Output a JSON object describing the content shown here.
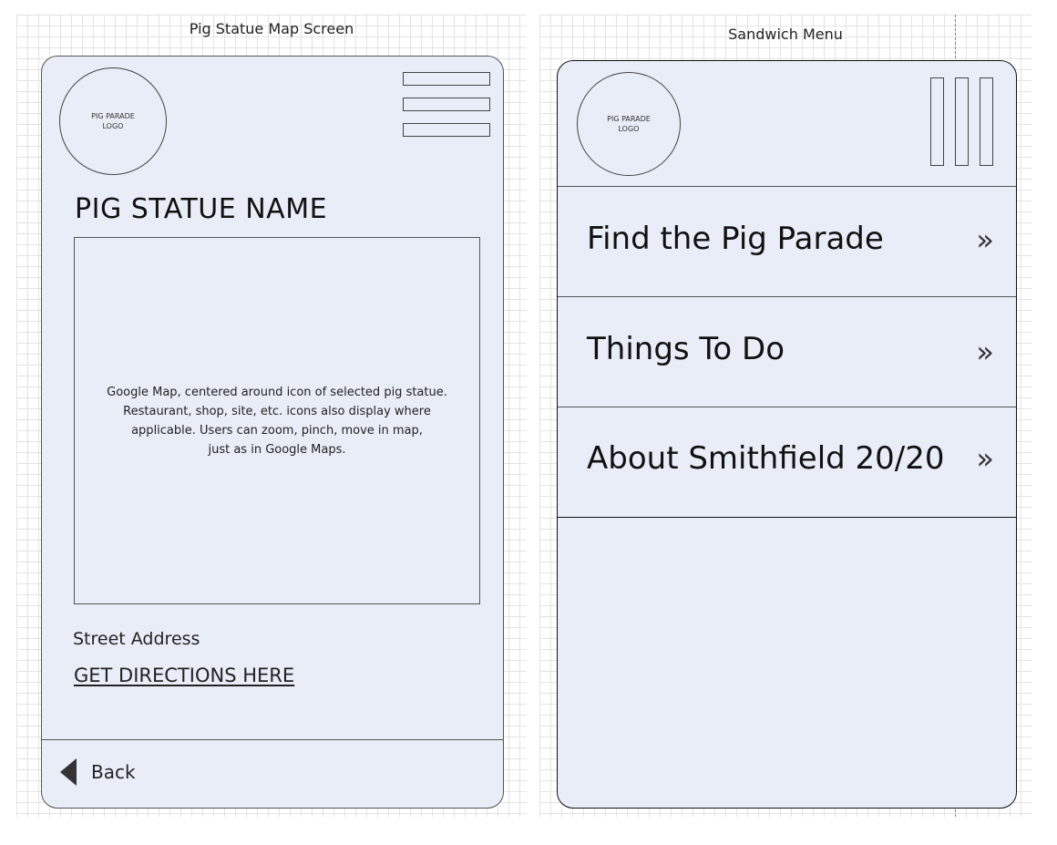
{
  "left_screen": {
    "caption": "Pig Statue Map Screen",
    "logo_text": "PIG PARADE\nLOGO",
    "statue_title": "PIG STATUE NAME",
    "map_description": "Google Map, centered around icon of selected pig statue.\nRestaurant, shop, site, etc. icons also display where\napplicable. Users can zoom, pinch, move in map,\njust as in Google Maps.",
    "street_address": "Street Address",
    "directions_link": "GET DIRECTIONS HERE",
    "back_label": "Back"
  },
  "right_screen": {
    "caption": "Sandwich Menu",
    "logo_text": "PIG PARADE\nLOGO",
    "menu_items": [
      {
        "label": "Find the Pig Parade",
        "chevron": "»"
      },
      {
        "label": "Things To Do",
        "chevron": "»"
      },
      {
        "label": "About Smithfield 20/20",
        "chevron": "»"
      }
    ]
  },
  "colors": {
    "phone_fill": "#e8edf7",
    "grid_line": "#e3e3e3",
    "guide_line": "#6b7fff"
  },
  "icons": {
    "hamburger": "hamburger-menu-icon",
    "vertical_menu": "vertical-bars-menu-icon",
    "back": "back-arrow-icon",
    "chevron": "double-chevron-right-icon"
  }
}
